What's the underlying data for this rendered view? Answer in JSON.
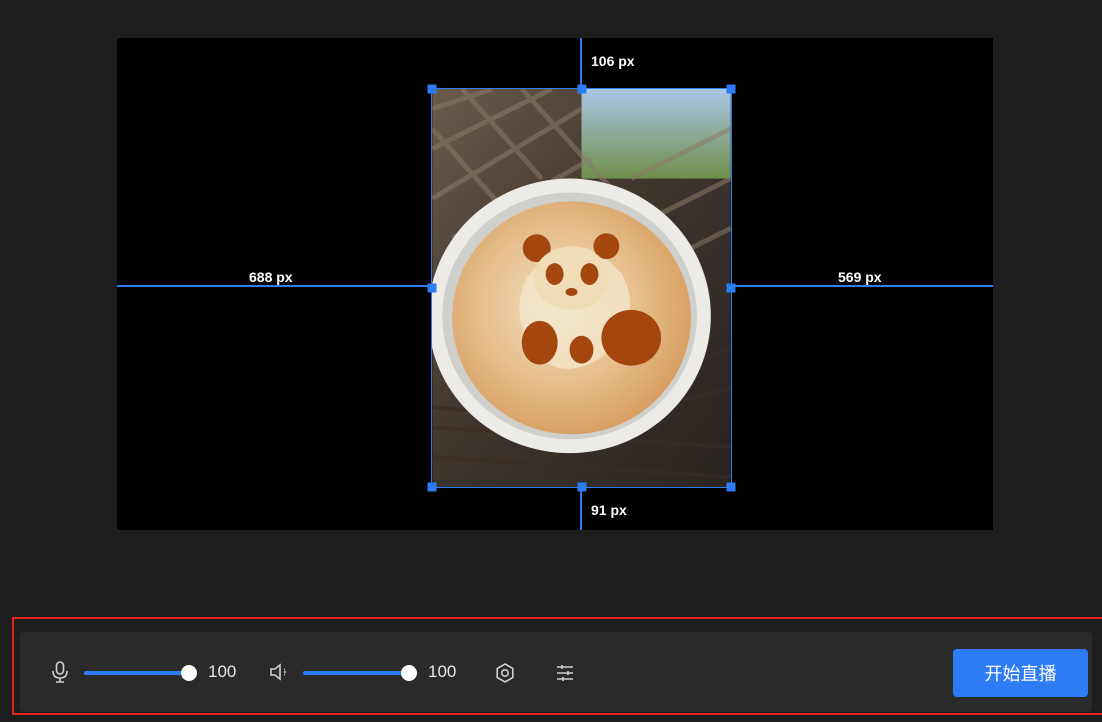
{
  "canvas": {
    "distance_top": "106 px",
    "distance_bottom": "91 px",
    "distance_left": "688 px",
    "distance_right": "569 px",
    "source_image": "panda-latte-art-photo"
  },
  "toolbar": {
    "mic_volume": 100,
    "mic_volume_label": "100",
    "speaker_volume": 100,
    "speaker_volume_label": "100",
    "start_live_label": "开始直播"
  },
  "colors": {
    "accent": "#2d7cf6",
    "highlight": "#e0261b"
  }
}
